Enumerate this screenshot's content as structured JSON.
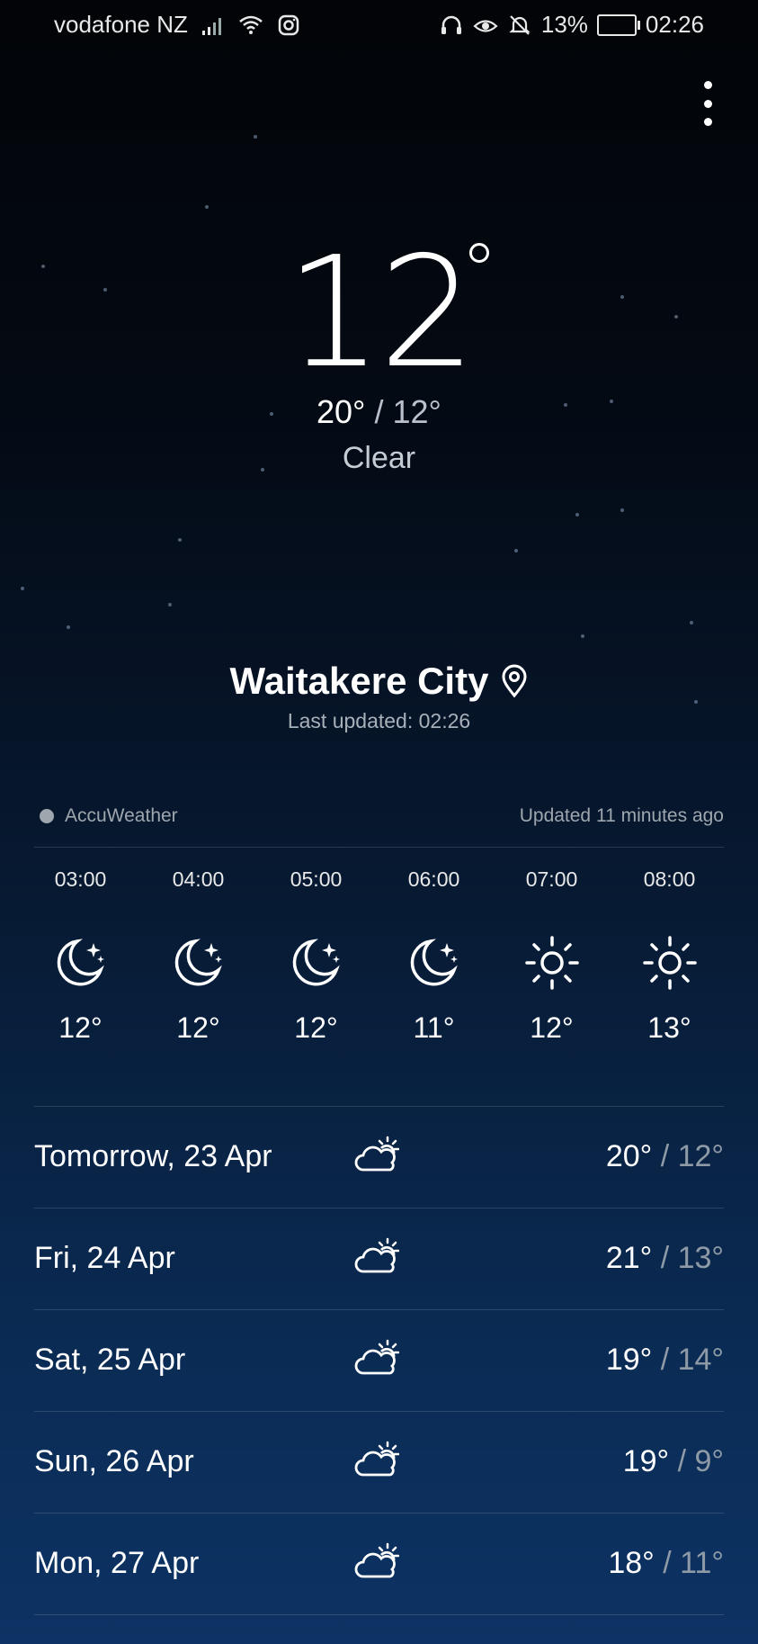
{
  "status_bar": {
    "carrier": "vodafone NZ",
    "battery": "13%",
    "time": "02:26",
    "icons": [
      "signal-icon",
      "wifi-icon",
      "instagram-icon",
      "headphones-icon",
      "eye-comfort-icon",
      "bell-muted-icon",
      "battery-charging-icon"
    ]
  },
  "current": {
    "temperature": "12",
    "high": "20°",
    "separator": "/",
    "low": "12°",
    "condition": "Clear"
  },
  "location": {
    "city": "Waitakere City",
    "last_updated": "Last updated: 02:26"
  },
  "provider": {
    "name": "AccuWeather",
    "updated": "Updated 11 minutes ago"
  },
  "hourly": [
    {
      "time": "03:00",
      "icon": "moon-stars-icon",
      "temp": "12°"
    },
    {
      "time": "04:00",
      "icon": "moon-stars-icon",
      "temp": "12°"
    },
    {
      "time": "05:00",
      "icon": "moon-stars-icon",
      "temp": "12°"
    },
    {
      "time": "06:00",
      "icon": "moon-stars-icon",
      "temp": "11°"
    },
    {
      "time": "07:00",
      "icon": "sun-icon",
      "temp": "12°"
    },
    {
      "time": "08:00",
      "icon": "sun-icon",
      "temp": "13°"
    }
  ],
  "daily": [
    {
      "day": "Tomorrow, 23 Apr",
      "icon": "partly-cloudy-icon",
      "high": "20°",
      "low": "/ 12°"
    },
    {
      "day": "Fri, 24 Apr",
      "icon": "partly-cloudy-icon",
      "high": "21°",
      "low": "/ 13°"
    },
    {
      "day": "Sat, 25 Apr",
      "icon": "partly-cloudy-icon",
      "high": "19°",
      "low": "/ 14°"
    },
    {
      "day": "Sun, 26 Apr",
      "icon": "partly-cloudy-icon",
      "high": "19°",
      "low": "/ 9°"
    },
    {
      "day": "Mon, 27 Apr",
      "icon": "partly-cloudy-icon",
      "high": "18°",
      "low": "/ 11°"
    }
  ]
}
